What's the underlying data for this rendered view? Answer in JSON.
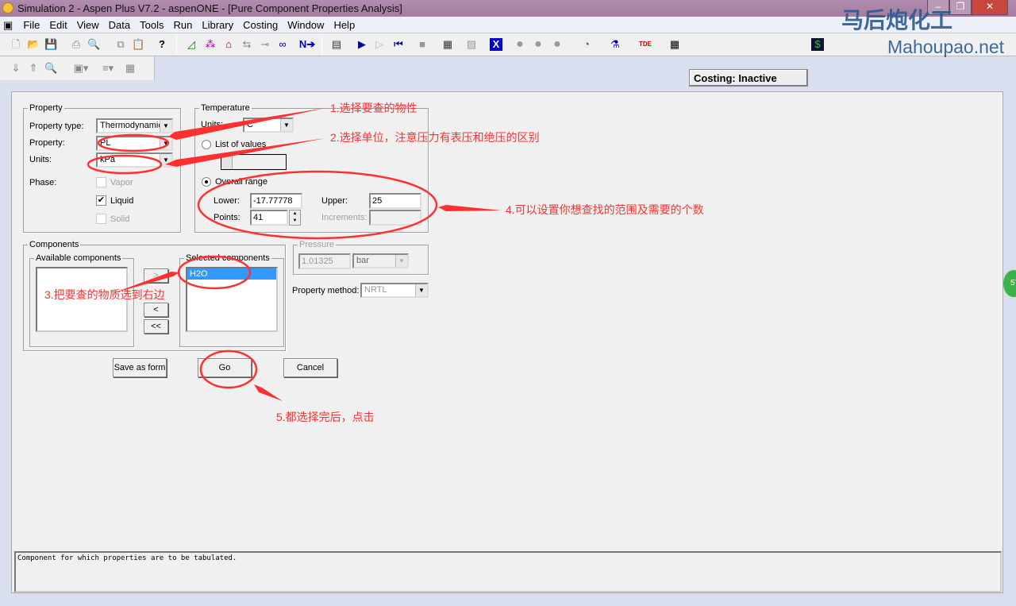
{
  "window": {
    "title": "Simulation 2 - Aspen Plus V7.2 - aspenONE - [Pure Component Properties Analysis]",
    "minimize": "–",
    "restore": "❐",
    "close": "✕"
  },
  "menu": [
    "File",
    "Edit",
    "View",
    "Data",
    "Tools",
    "Run",
    "Library",
    "Costing",
    "Window",
    "Help"
  ],
  "toolbar": {
    "costing_status": "Costing: Inactive",
    "help_icon": "?",
    "next_icon": "N➔"
  },
  "watermark": {
    "cn": "马后炮化工",
    "site": "Mahoupao.net"
  },
  "notification_badge": "57",
  "property": {
    "legend": "Property",
    "type_label": "Property type:",
    "type_value": "Thermodynamic",
    "property_label": "Property:",
    "property_value": "PL",
    "units_label": "Units:",
    "units_value": "kPa",
    "phase_label": "Phase:",
    "phases": [
      {
        "label": "Vapor",
        "checked": false,
        "enabled": false
      },
      {
        "label": "Liquid",
        "checked": true,
        "enabled": true
      },
      {
        "label": "Solid",
        "checked": false,
        "enabled": false
      }
    ]
  },
  "temperature": {
    "legend": "Temperature",
    "units_label": "Units:",
    "units_value": "C",
    "list_label": "List of values",
    "range_label": "Overall range",
    "selected": "Overall range",
    "lower_label": "Lower:",
    "lower": "-17.77778",
    "upper_label": "Upper:",
    "upper": "25",
    "points_label": "Points:",
    "points": "41",
    "increments_label": "Increments:",
    "increments": ""
  },
  "pressure": {
    "legend": "Pressure",
    "value": "1.01325",
    "units": "bar"
  },
  "property_method": {
    "label": "Property method:",
    "value": "NRTL"
  },
  "components": {
    "legend": "Components",
    "available_legend": "Available components",
    "available": [],
    "selected_legend": "Selected components",
    "selected": [
      "H2O"
    ],
    "move_right": ">",
    "move_left": "<",
    "move_all_left": "<<"
  },
  "buttons": {
    "save": "Save as form",
    "go": "Go",
    "cancel": "Cancel"
  },
  "status": "Component for which properties are to be tabulated.",
  "annotations": {
    "a1": "1.选择要查的物性",
    "a2": "2.选择单位，注意压力有表压和绝压的区别",
    "a3": "3.把要查的物质选到右边",
    "a4": "4.可以设置你想查找的范围及需要的个数",
    "a5": "5.都选择完后，点击"
  },
  "colors": {
    "annotation": "#ff3030",
    "selection": "#3399ff",
    "titlebar": "#a97fa6"
  }
}
